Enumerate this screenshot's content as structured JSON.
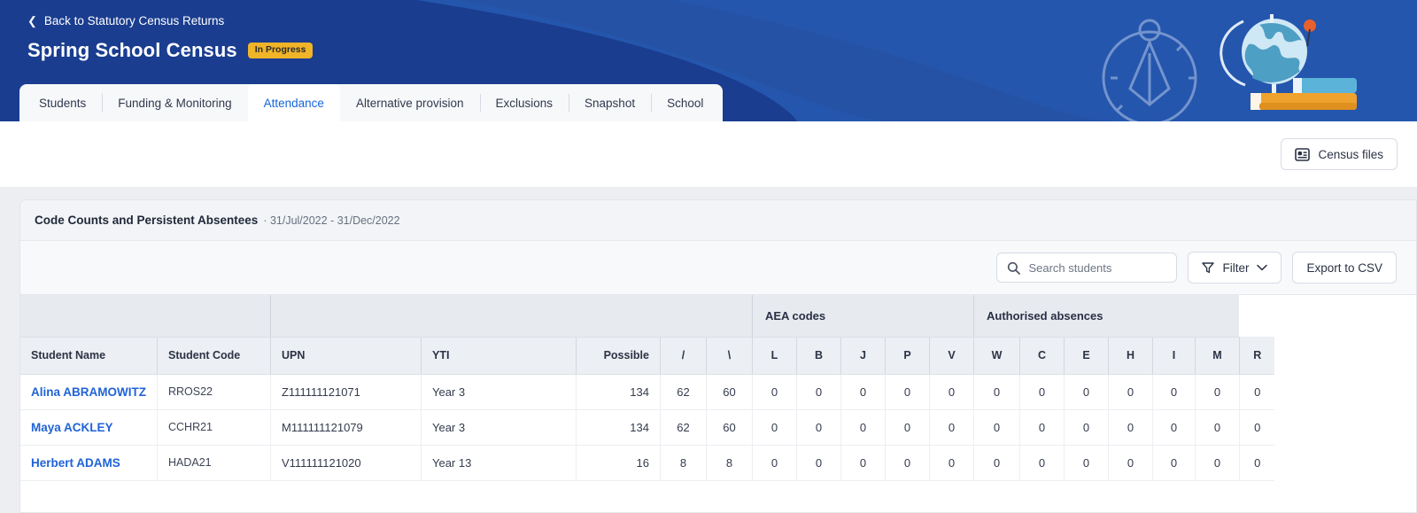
{
  "header": {
    "back_label": "Back to Statutory Census Returns",
    "back_icon": "chevron-left-icon",
    "title": "Spring School Census",
    "status_badge": "In Progress",
    "bg_color": "#1a3d8f",
    "wave_color": "#2456ad",
    "badge_color": "#f0b429",
    "art": "compass-globe-books-illustration"
  },
  "tabs": [
    {
      "label": "Students",
      "active": false
    },
    {
      "label": "Funding & Monitoring",
      "active": false
    },
    {
      "label": "Attendance",
      "active": true
    },
    {
      "label": "Alternative provision",
      "active": false
    },
    {
      "label": "Exclusions",
      "active": false
    },
    {
      "label": "Snapshot",
      "active": false
    },
    {
      "label": "School",
      "active": false
    }
  ],
  "subbar": {
    "census_files_label": "Census files",
    "census_files_icon": "id-card-icon"
  },
  "panel": {
    "title": "Code Counts and Persistent Absentees",
    "subtitle": "· 31/Jul/2022 - 31/Dec/2022",
    "search_placeholder": "Search students",
    "search_value": "",
    "search_icon": "search-icon",
    "filter_label": "Filter",
    "filter_icon": "funnel-icon",
    "filter_chevron": "chevron-down-icon",
    "export_label": "Export to CSV"
  },
  "table": {
    "group_headers": [
      {
        "label": "",
        "span": 2,
        "sep": false
      },
      {
        "label": "",
        "span": 5,
        "sep": true
      },
      {
        "label": "AEA codes",
        "span": 5,
        "sep": true
      },
      {
        "label": "Authorised absences",
        "span": 6,
        "sep": true
      }
    ],
    "columns": [
      {
        "key": "name",
        "label": "Student Name",
        "align": "l",
        "sep": false
      },
      {
        "key": "code",
        "label": "Student Code",
        "align": "l",
        "sep": true
      },
      {
        "key": "upn",
        "label": "UPN",
        "align": "l",
        "sep": true
      },
      {
        "key": "yti",
        "label": "YTI",
        "align": "l",
        "sep": true
      },
      {
        "key": "possible",
        "label": "Possible",
        "align": "r",
        "sep": true
      },
      {
        "key": "slash",
        "label": "/",
        "align": "c",
        "sep": true
      },
      {
        "key": "bslash",
        "label": "\\",
        "align": "c",
        "sep": true
      },
      {
        "key": "L",
        "label": "L",
        "align": "c",
        "sep": true
      },
      {
        "key": "B",
        "label": "B",
        "align": "c",
        "sep": true
      },
      {
        "key": "J",
        "label": "J",
        "align": "c",
        "sep": true
      },
      {
        "key": "P",
        "label": "P",
        "align": "c",
        "sep": true
      },
      {
        "key": "V",
        "label": "V",
        "align": "c",
        "sep": true
      },
      {
        "key": "W",
        "label": "W",
        "align": "c",
        "sep": true
      },
      {
        "key": "C",
        "label": "C",
        "align": "c",
        "sep": true
      },
      {
        "key": "E",
        "label": "E",
        "align": "c",
        "sep": true
      },
      {
        "key": "H",
        "label": "H",
        "align": "c",
        "sep": true
      },
      {
        "key": "I",
        "label": "I",
        "align": "c",
        "sep": true
      },
      {
        "key": "M",
        "label": "M",
        "align": "c",
        "sep": true
      },
      {
        "key": "R",
        "label": "R",
        "align": "c",
        "sep": true
      }
    ],
    "rows": [
      {
        "name": "Alina ABRAMOWITZ",
        "code": "RROS22",
        "upn": "Z111111121071",
        "yti": "Year 3",
        "possible": "134",
        "slash": "62",
        "bslash": "60",
        "L": "0",
        "B": "0",
        "J": "0",
        "P": "0",
        "V": "0",
        "W": "0",
        "C": "0",
        "E": "0",
        "H": "0",
        "I": "0",
        "M": "0",
        "R": "0"
      },
      {
        "name": "Maya ACKLEY",
        "code": "CCHR21",
        "upn": "M111111121079",
        "yti": "Year 3",
        "possible": "134",
        "slash": "62",
        "bslash": "60",
        "L": "0",
        "B": "0",
        "J": "0",
        "P": "0",
        "V": "0",
        "W": "0",
        "C": "0",
        "E": "0",
        "H": "0",
        "I": "0",
        "M": "0",
        "R": "0"
      },
      {
        "name": "Herbert ADAMS",
        "code": "HADA21",
        "upn": "V111111121020",
        "yti": "Year 13",
        "possible": "16",
        "slash": "8",
        "bslash": "8",
        "L": "0",
        "B": "0",
        "J": "0",
        "P": "0",
        "V": "0",
        "W": "0",
        "C": "0",
        "E": "0",
        "H": "0",
        "I": "0",
        "M": "0",
        "R": "0"
      }
    ]
  }
}
